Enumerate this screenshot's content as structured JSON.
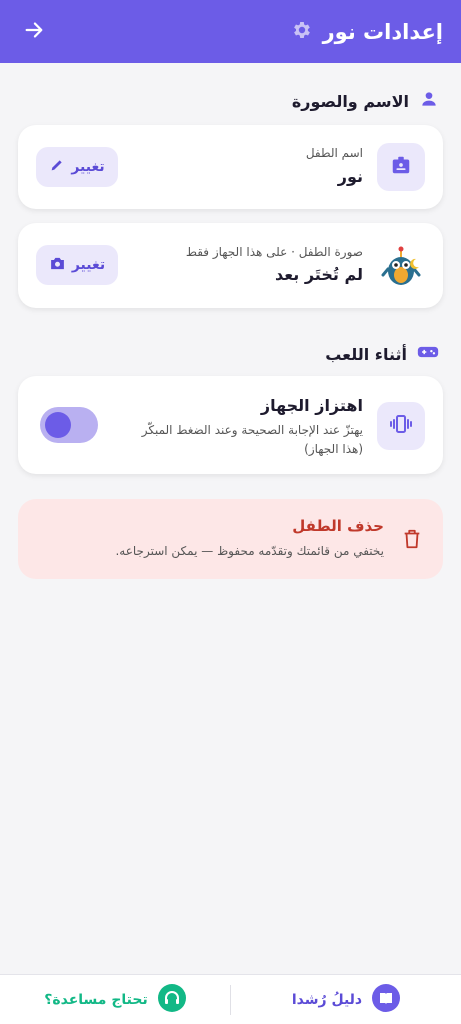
{
  "header": {
    "title": "إعدادات نور",
    "settings_icon": "gear-icon",
    "back_icon": "arrow-right-icon"
  },
  "section_name_photo": {
    "title": "الاسم والصورة",
    "icon": "person-icon"
  },
  "name_card": {
    "label": "اسم الطفل",
    "value": "نور",
    "button_label": "تغيير"
  },
  "photo_card": {
    "label": "صورة الطفل · على هذا الجهاز فقط",
    "value": "لم تُختَر بعد",
    "button_label": "تغيير"
  },
  "section_play": {
    "title": "أثناء اللعب",
    "icon": "gamepad-icon"
  },
  "vibration_card": {
    "title": "اهتزاز الجهاز",
    "description_line1": "يهتزّ عند الإجابة الصحيحة وعند الضغط المبكّر",
    "description_line2": "(هذا الجهاز)",
    "toggle_on": false
  },
  "delete_card": {
    "title": "حذف الطفل",
    "description": "يختفي من قائمتك وتقدّمه محفوظ — يمكن استرجاعه."
  },
  "bottom_bar": {
    "help_label": "تحتاج مساعدة؟",
    "guide_label": "دليلُ رُشدا"
  },
  "colors": {
    "primary": "#6c5ce7",
    "danger": "#c0392b",
    "help": "#12b886"
  }
}
